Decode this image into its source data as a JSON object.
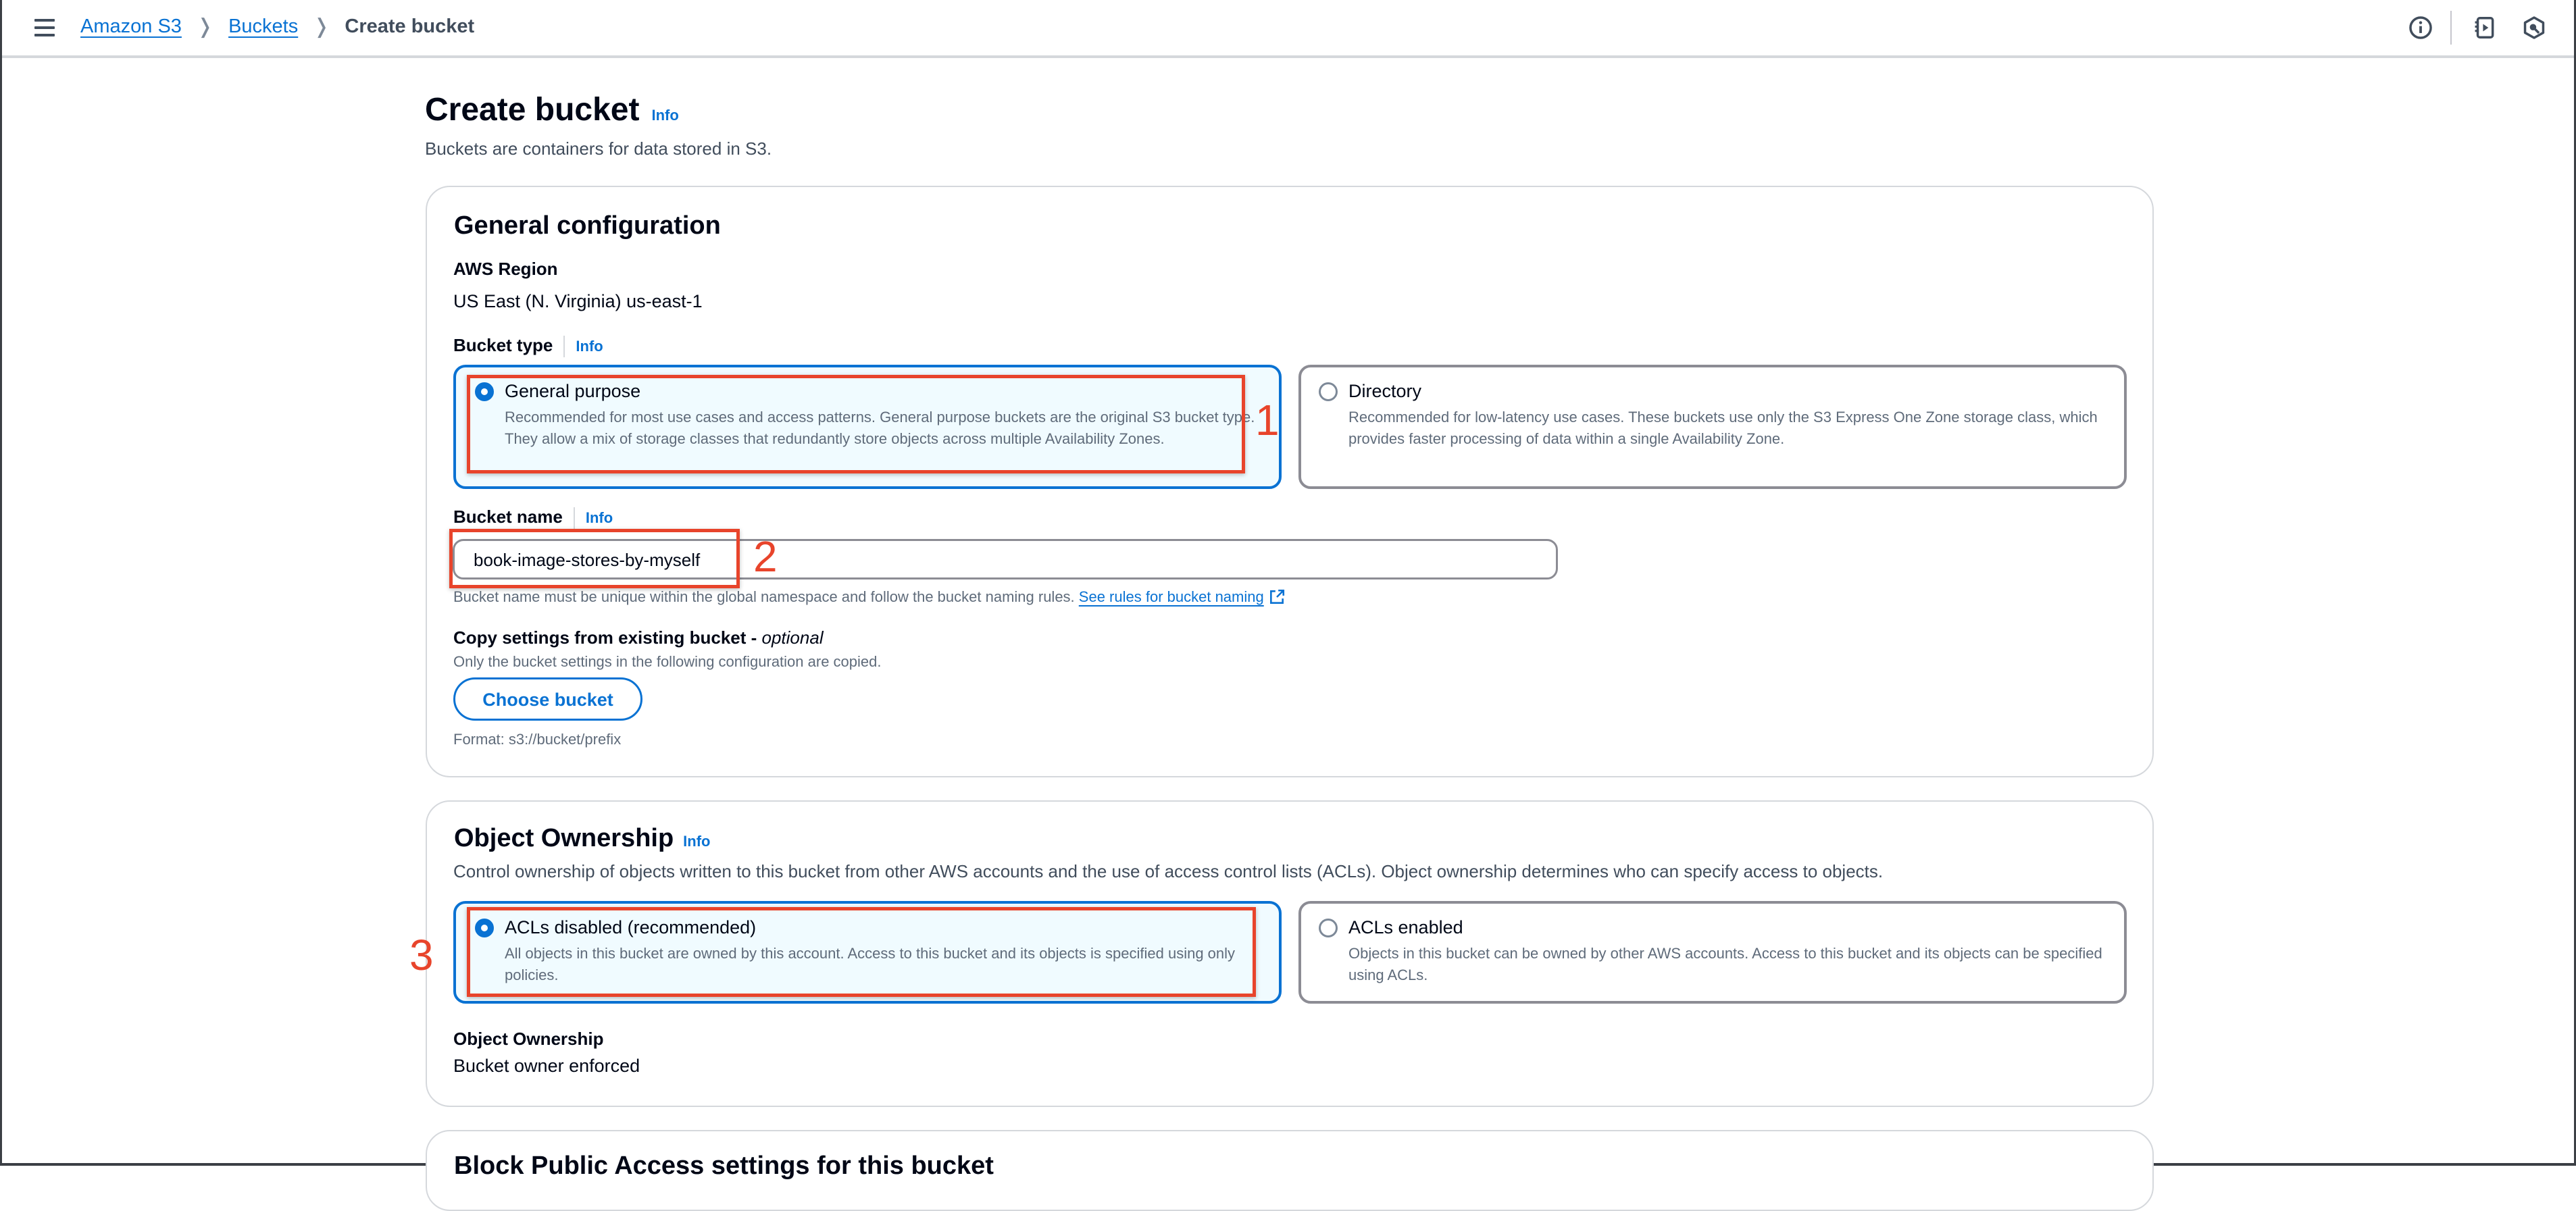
{
  "header": {
    "menu_icon": "hamburger-menu-icon",
    "breadcrumbs": [
      {
        "label": "Amazon S3",
        "link": true
      },
      {
        "label": "Buckets",
        "link": true
      },
      {
        "label": "Create bucket",
        "link": false
      }
    ],
    "right_icons": [
      "info-circle-icon",
      "notebook-play-icon",
      "hexagon-search-icon"
    ]
  },
  "page": {
    "title": "Create bucket",
    "info": "Info",
    "description": "Buckets are containers for data stored in S3."
  },
  "general_configuration": {
    "heading": "General configuration",
    "region_label": "AWS Region",
    "region_value": "US East (N. Virginia) us-east-1",
    "bucket_type_label": "Bucket type",
    "bucket_type_info": "Info",
    "bucket_type_options": [
      {
        "title": "General purpose",
        "description": "Recommended for most use cases and access patterns. General purpose buckets are the original S3 bucket type. They allow a mix of storage classes that redundantly store objects across multiple Availability Zones.",
        "selected": true
      },
      {
        "title": "Directory",
        "description": "Recommended for low-latency use cases. These buckets use only the S3 Express One Zone storage class, which provides faster processing of data within a single Availability Zone.",
        "selected": false
      }
    ],
    "bucket_name_label": "Bucket name",
    "bucket_name_info": "Info",
    "bucket_name_value": "book-image-stores-by-myself",
    "bucket_name_hint": "Bucket name must be unique within the global namespace and follow the bucket naming rules.",
    "bucket_name_rules_link": "See rules for bucket naming",
    "copy_settings_label": "Copy settings from existing bucket - ",
    "copy_settings_optional": "optional",
    "copy_settings_hint": "Only the bucket settings in the following configuration are copied.",
    "choose_bucket_button": "Choose bucket",
    "format_hint": "Format: s3://bucket/prefix"
  },
  "object_ownership": {
    "heading": "Object Ownership",
    "info": "Info",
    "description": "Control ownership of objects written to this bucket from other AWS accounts and the use of access control lists (ACLs). Object ownership determines who can specify access to objects.",
    "options": [
      {
        "title": "ACLs disabled (recommended)",
        "description": "All objects in this bucket are owned by this account. Access to this bucket and its objects is specified using only policies.",
        "selected": true
      },
      {
        "title": "ACLs enabled",
        "description": "Objects in this bucket can be owned by other AWS accounts. Access to this bucket and its objects can be specified using ACLs.",
        "selected": false
      }
    ],
    "result_label": "Object Ownership",
    "result_value": "Bucket owner enforced"
  },
  "block_public_access": {
    "heading": "Block Public Access settings for this bucket"
  },
  "annotations": {
    "color": "#e8442b",
    "labels": [
      "1",
      "2",
      "3"
    ]
  },
  "colors": {
    "accent": "#0972d3",
    "selected_tile_bg": "#f0fbff"
  }
}
